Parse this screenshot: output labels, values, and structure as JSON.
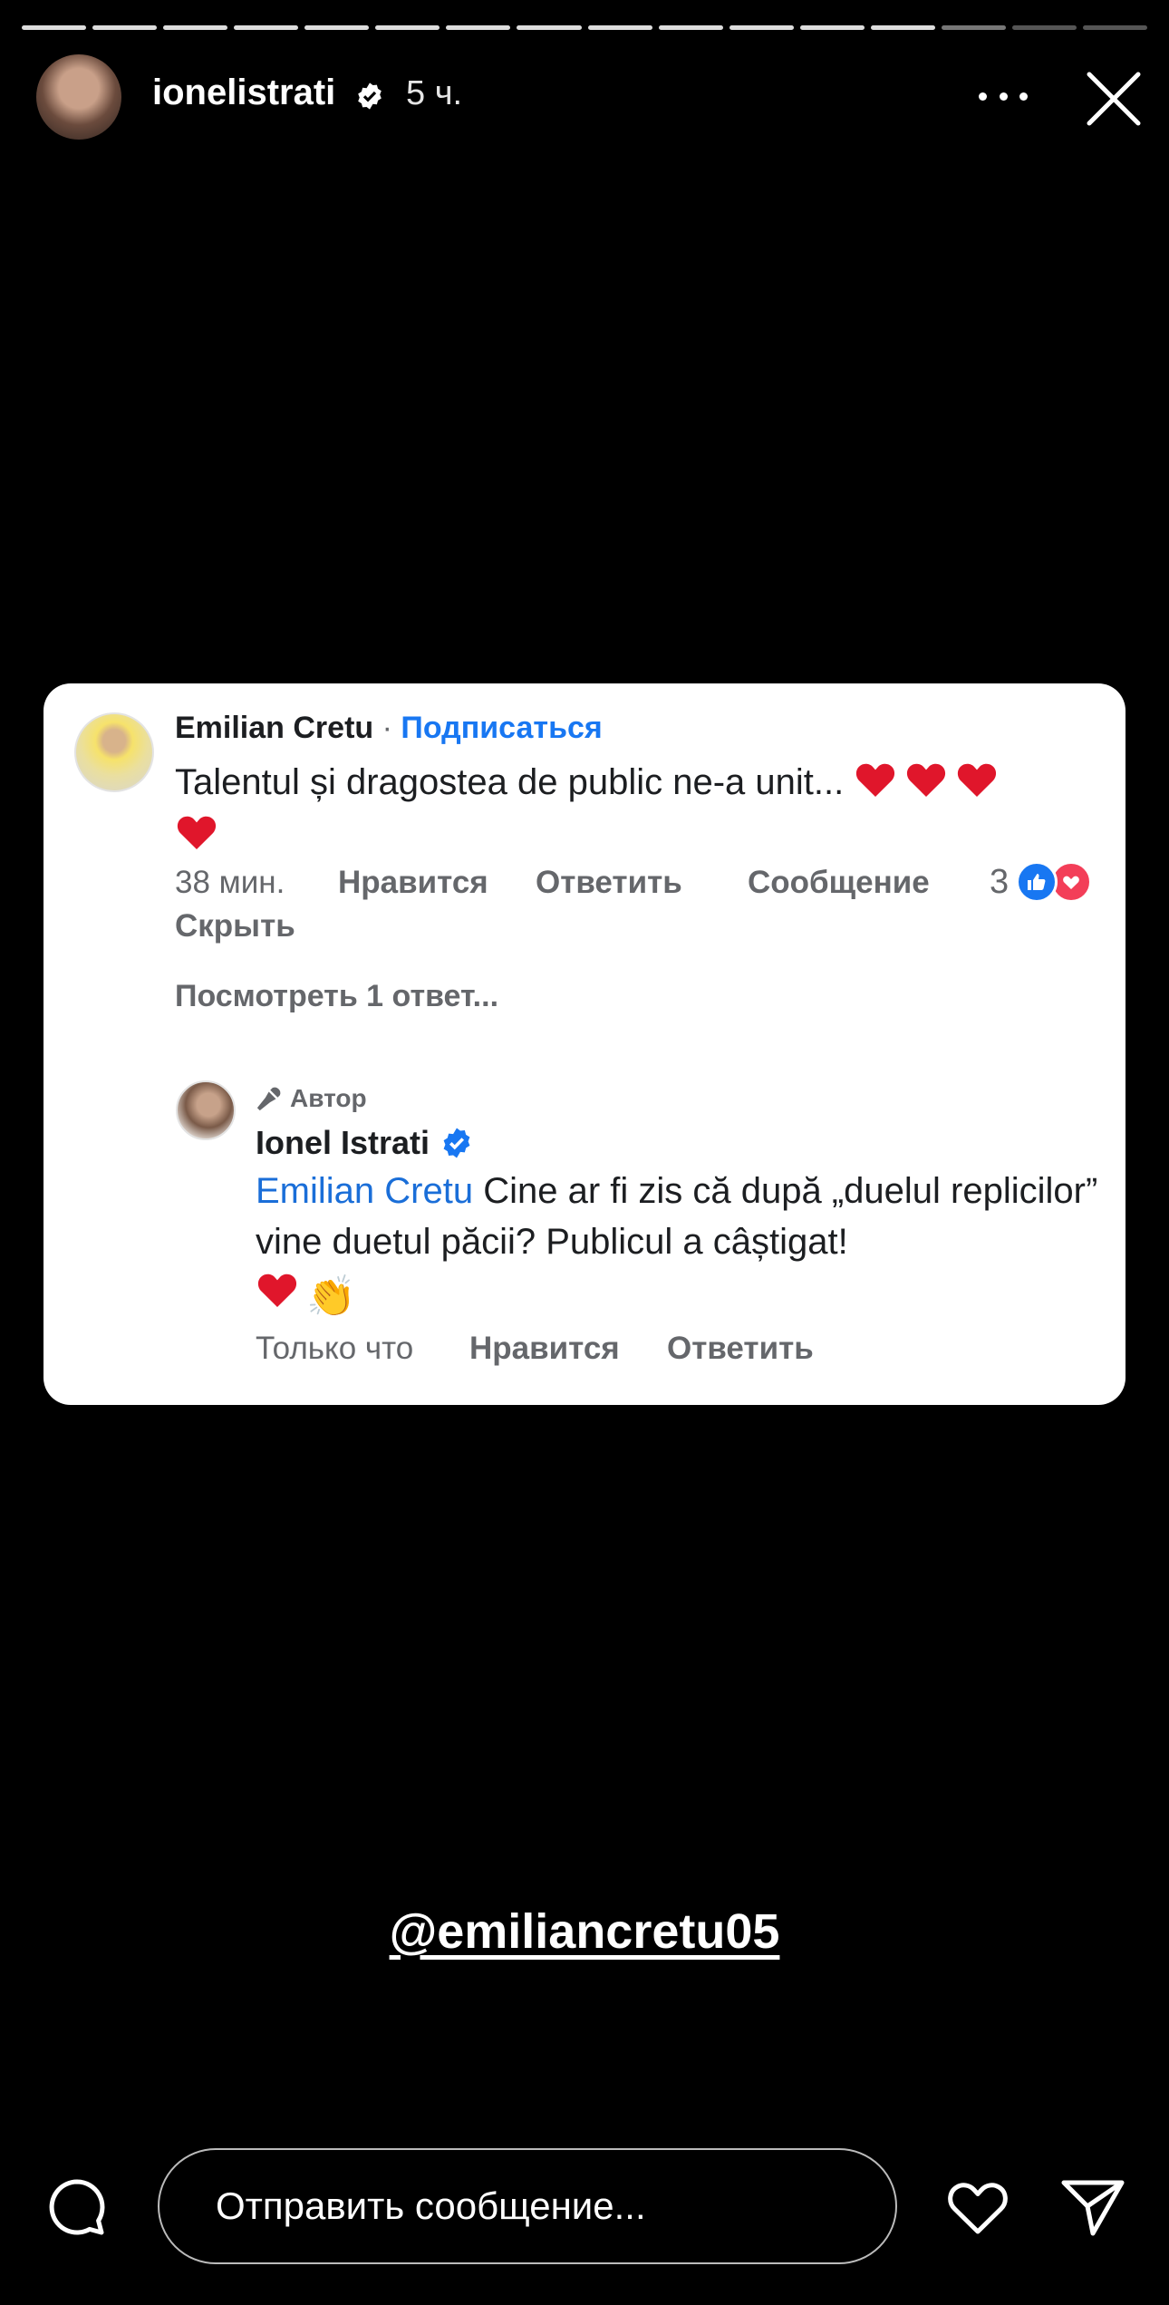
{
  "story": {
    "segments_total": 16,
    "segments_viewed": 13,
    "user": {
      "username": "ionelistrati",
      "verified": true,
      "posted_ago": "5 ч."
    }
  },
  "comment": {
    "author": "Emilian Cretu",
    "separator": "·",
    "follow_label": "Подписаться",
    "text": "Talentul și dragostea de public ne-a unit...",
    "time": "38 мин.",
    "actions": [
      "Нравится",
      "Ответить",
      "Сообщение",
      "Скрыть"
    ],
    "reaction_count": "3",
    "view_replies": "Посмотреть 1 ответ..."
  },
  "reply": {
    "badge": "Автор",
    "author": "Ionel Istrati",
    "mention": "Emilian Cretu",
    "text": " Cine ar fi zis că după „duelul replicilor” vine duetul păcii? Publicul a câștigat!",
    "clap_emoji": "👏",
    "time": "Только что",
    "actions": [
      "Нравится",
      "Ответить"
    ]
  },
  "sticker": {
    "mention_text": "@emiliancretu05"
  },
  "bottom_bar": {
    "message_placeholder": "Отправить сообщение..."
  },
  "colors": {
    "link_blue": "#1877f2",
    "heart_red": "#e0162b",
    "background": "#000000"
  }
}
